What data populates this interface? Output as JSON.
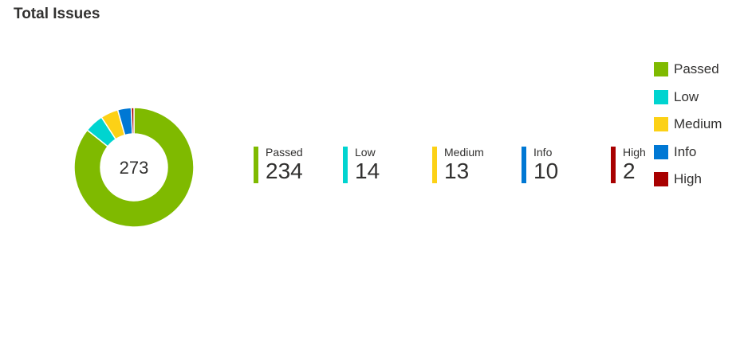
{
  "title": "Total Issues",
  "chart_data": {
    "type": "donut",
    "center_label": "273",
    "categories": [
      "Passed",
      "Low",
      "Medium",
      "Info",
      "High"
    ],
    "values": [
      234,
      14,
      13,
      10,
      2
    ],
    "colors": [
      "#7fba00",
      "#00d4d0",
      "#fcd116",
      "#0078d4",
      "#a80000"
    ],
    "legend_position": "right"
  },
  "stats": [
    {
      "label": "Passed",
      "value": "234",
      "color": "#7fba00"
    },
    {
      "label": "Low",
      "value": "14",
      "color": "#00d4d0"
    },
    {
      "label": "Medium",
      "value": "13",
      "color": "#fcd116"
    },
    {
      "label": "Info",
      "value": "10",
      "color": "#0078d4"
    },
    {
      "label": "High",
      "value": "2",
      "color": "#a80000"
    }
  ],
  "legend": [
    {
      "label": "Passed",
      "color": "#7fba00"
    },
    {
      "label": "Low",
      "color": "#00d4d0"
    },
    {
      "label": "Medium",
      "color": "#fcd116"
    },
    {
      "label": "Info",
      "color": "#0078d4"
    },
    {
      "label": "High",
      "color": "#a80000"
    }
  ]
}
